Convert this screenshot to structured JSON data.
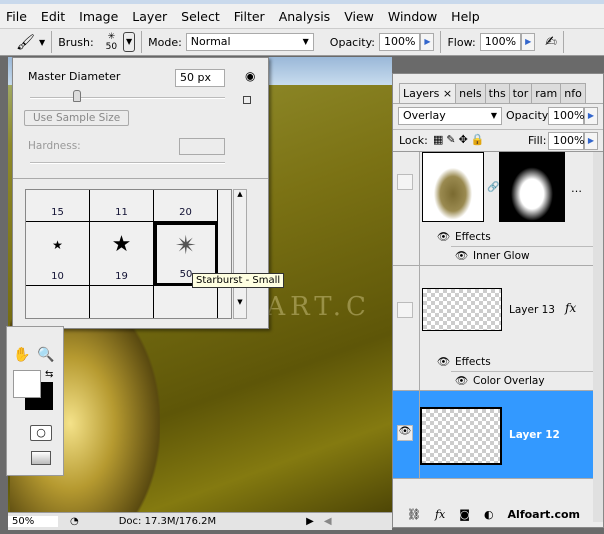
{
  "menu": [
    "File",
    "Edit",
    "Image",
    "Layer",
    "Select",
    "Filter",
    "Analysis",
    "View",
    "Window",
    "Help"
  ],
  "options": {
    "brush_label": "Brush:",
    "brush_size": "50",
    "mode_label": "Mode:",
    "mode_value": "Normal",
    "opacity_label": "Opacity:",
    "opacity_value": "100%",
    "flow_label": "Flow:",
    "flow_value": "100%"
  },
  "brush_panel": {
    "master_diameter_label": "Master Diameter",
    "master_diameter_value": "50 px",
    "master_diameter_fraction": 0.24,
    "use_sample_size": "Use Sample Size",
    "hardness_label": "Hardness:",
    "presets": [
      "15",
      "11",
      "20",
      "10",
      "19",
      "50"
    ],
    "tooltip": "Starburst - Small"
  },
  "status": {
    "zoom": "50%",
    "doc": "Doc: 17.3M/176.2M"
  },
  "watermark": "OART.C",
  "layers_panel": {
    "tabs": [
      "Layers",
      "nels",
      "ths",
      "tor",
      "ram",
      "nfo"
    ],
    "blend_mode": "Overlay",
    "opacity_label": "Opacity:",
    "opacity_value": "100%",
    "lock_label": "Lock:",
    "fill_label": "Fill:",
    "fill_value": "100%",
    "layers": [
      {
        "effects": "Effects",
        "effect": "Inner Glow"
      },
      {
        "name": "Layer 13",
        "effects": "Effects",
        "effect": "Color Overlay"
      },
      {
        "name": "Layer 12"
      }
    ],
    "footer_logo": "Alfoart.com"
  },
  "colors": {
    "selection": "#3399ff",
    "canvas": "#7b7214"
  }
}
